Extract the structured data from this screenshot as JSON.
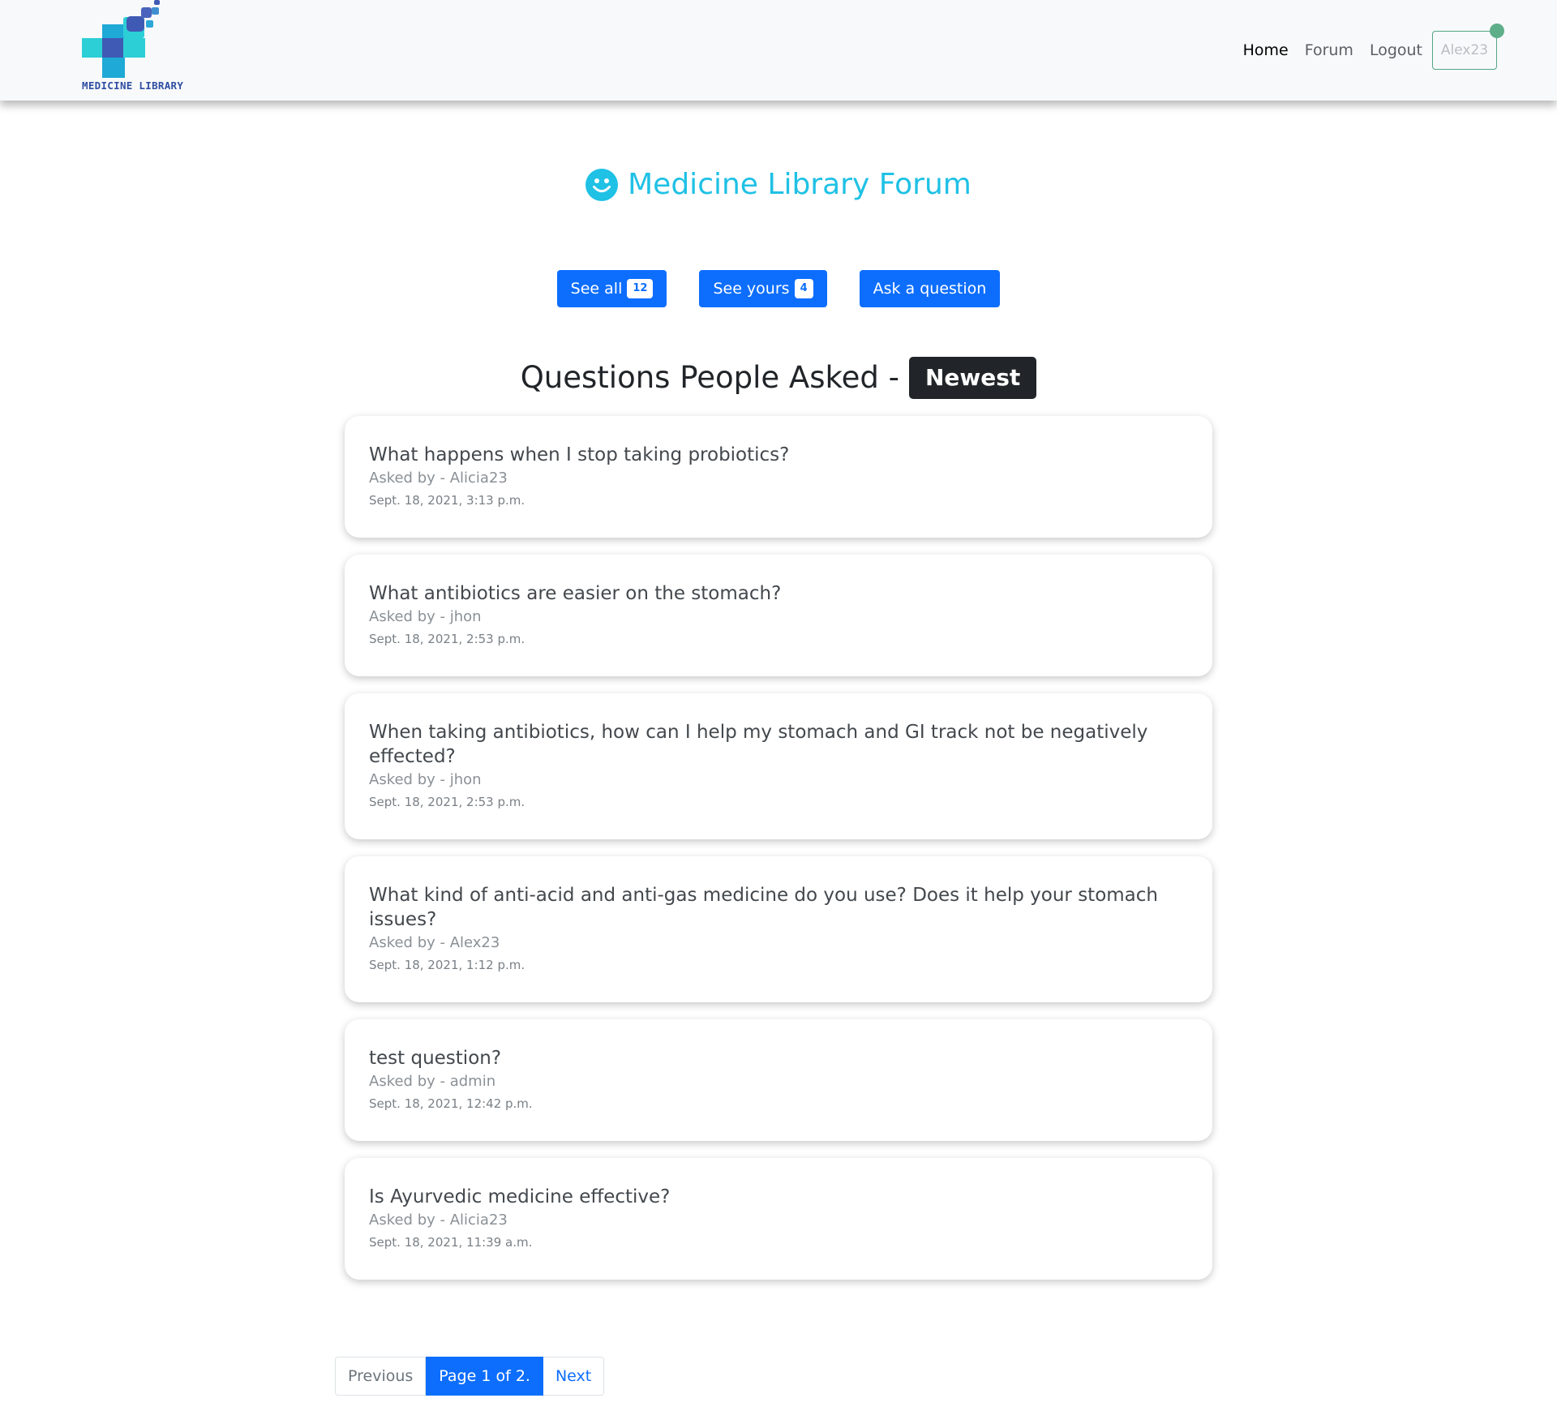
{
  "brand": {
    "name": "MEDICINE LIBRARY"
  },
  "nav": {
    "items": [
      {
        "label": "Home"
      },
      {
        "label": "Forum"
      },
      {
        "label": "Logout"
      }
    ],
    "username": "Alex23"
  },
  "header": {
    "title": "Medicine Library Forum",
    "icon": "smile-icon",
    "color": "#1fc1e5"
  },
  "actions": {
    "see_all_label": "See all",
    "see_all_count": "12",
    "see_yours_label": "See yours",
    "see_yours_count": "4",
    "ask_label": "Ask a question"
  },
  "section": {
    "title": "Questions People Asked -",
    "badge": "Newest"
  },
  "questions": [
    {
      "title": "What happens when I stop taking probiotics?",
      "author": "Asked by - Alicia23",
      "date": "Sept. 18, 2021, 3:13 p.m."
    },
    {
      "title": "What antibiotics are easier on the stomach?",
      "author": "Asked by - jhon",
      "date": "Sept. 18, 2021, 2:53 p.m."
    },
    {
      "title": "When taking antibiotics, how can I help my stomach and GI track not be negatively effected?",
      "author": "Asked by - jhon",
      "date": "Sept. 18, 2021, 2:53 p.m."
    },
    {
      "title": "What kind of anti-acid and anti-gas medicine do you use? Does it help your stomach issues?",
      "author": "Asked by - Alex23",
      "date": "Sept. 18, 2021, 1:12 p.m."
    },
    {
      "title": "test question?",
      "author": "Asked by - admin",
      "date": "Sept. 18, 2021, 12:42 p.m."
    },
    {
      "title": "Is Ayurvedic medicine effective?",
      "author": "Asked by - Alicia23",
      "date": "Sept. 18, 2021, 11:39 a.m."
    }
  ],
  "pagination": {
    "previous_label": "Previous",
    "current_label": "Page 1 of 2.",
    "next_label": "Next"
  },
  "colors": {
    "primary": "#0d6efd",
    "accent": "#1fc1e5",
    "dark": "#212529",
    "status_online": "#5fae8a"
  }
}
